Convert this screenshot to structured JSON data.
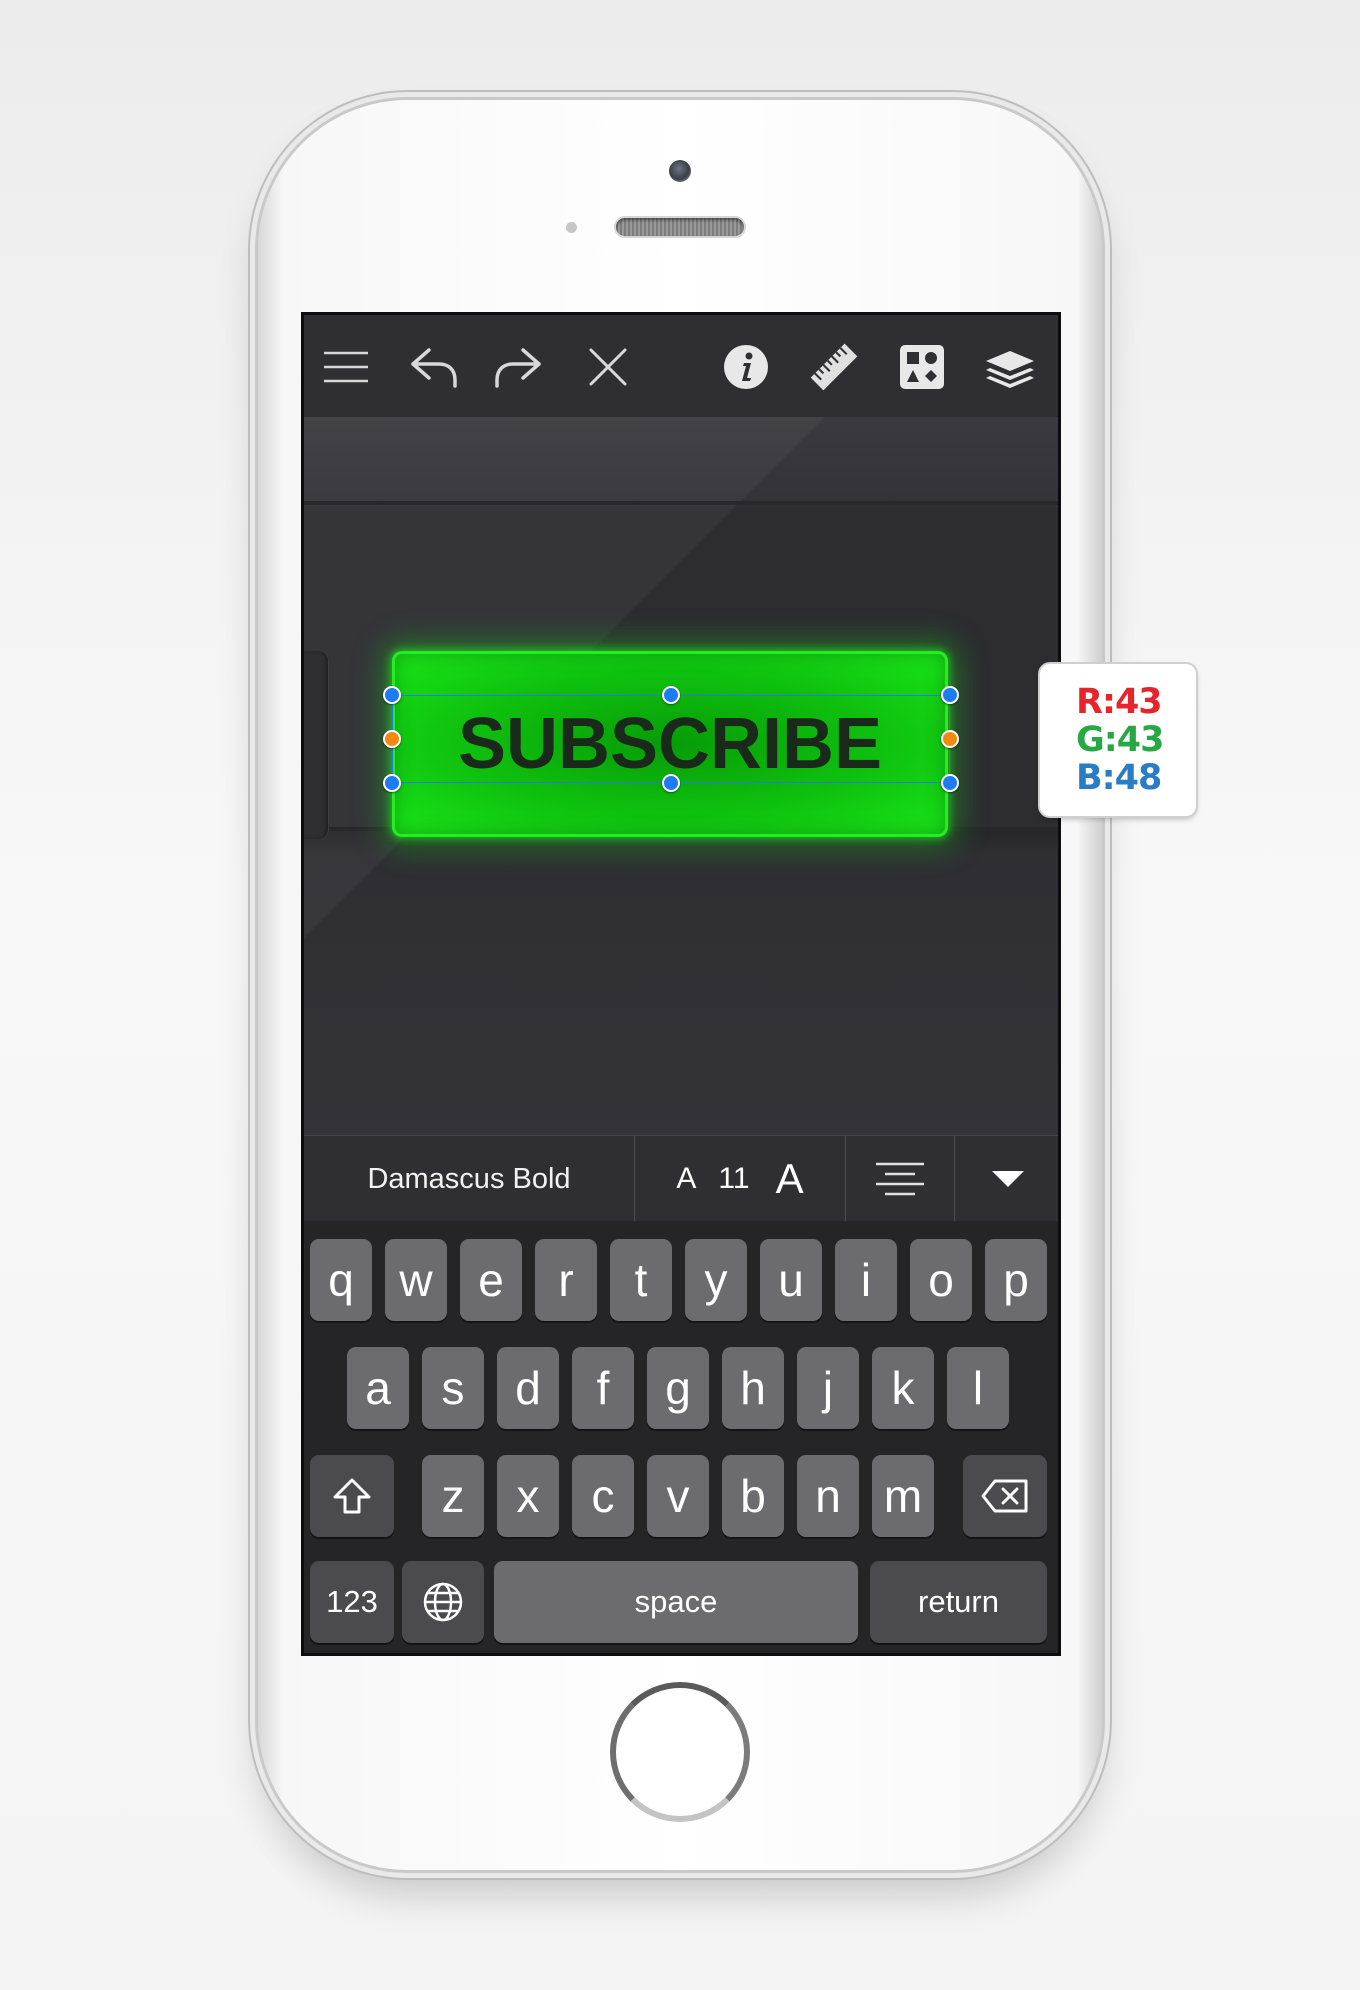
{
  "toolbar": {
    "icons": [
      "menu-icon",
      "undo-icon",
      "redo-icon",
      "close-icon",
      "info-icon",
      "ruler-icon",
      "shapes-icon",
      "layers-icon"
    ]
  },
  "canvas": {
    "button_text": "SUBSCRIBE",
    "button_color": "#10c410",
    "handle_color": "#1d7cf2",
    "midpoint_handle_color": "#f28a12"
  },
  "format_bar": {
    "font_name": "Damascus Bold",
    "size_decrease_label": "A",
    "font_size": "11",
    "size_increase_label": "A"
  },
  "keyboard": {
    "row1": [
      "q",
      "w",
      "e",
      "r",
      "t",
      "y",
      "u",
      "i",
      "o",
      "p"
    ],
    "row2": [
      "a",
      "s",
      "d",
      "f",
      "g",
      "h",
      "j",
      "k",
      "l"
    ],
    "row3": [
      "z",
      "x",
      "c",
      "v",
      "b",
      "n",
      "m"
    ],
    "numbers_label": "123",
    "space_label": "space",
    "return_label": "return"
  },
  "color_readout": {
    "r": "R:43",
    "g": "G:43",
    "b": "B:48",
    "r_color": "#e8242b",
    "g_color": "#27a845",
    "b_color": "#2b7cc7"
  }
}
